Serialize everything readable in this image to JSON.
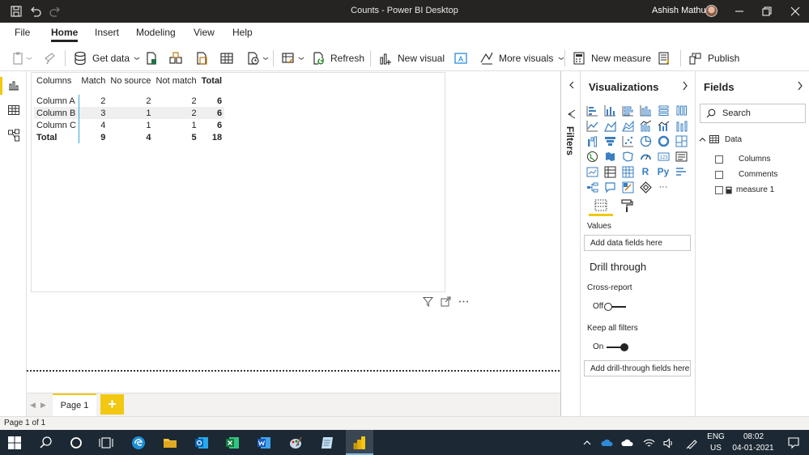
{
  "window": {
    "title": "Counts - Power BI Desktop",
    "user": "Ashish Mathur"
  },
  "ribbon": {
    "tabs": [
      "File",
      "Home",
      "Insert",
      "Modeling",
      "View",
      "Help"
    ],
    "active_tab": "Home",
    "buttons": {
      "get_data": "Get data",
      "refresh": "Refresh",
      "new_visual": "New visual",
      "more_visuals": "More visuals",
      "new_measure": "New measure",
      "publish": "Publish"
    }
  },
  "matrix": {
    "headers": [
      "Columns",
      "Match",
      "No source",
      "Not match",
      "Total"
    ],
    "rows": [
      {
        "label": "Column A",
        "values": [
          "2",
          "2",
          "2",
          "6"
        ]
      },
      {
        "label": "Column B",
        "values": [
          "3",
          "1",
          "2",
          "6"
        ]
      },
      {
        "label": "Column C",
        "values": [
          "4",
          "1",
          "1",
          "6"
        ]
      }
    ],
    "total": {
      "label": "Total",
      "values": [
        "9",
        "4",
        "5",
        "18"
      ]
    }
  },
  "pages": {
    "tabs": [
      "Page 1"
    ],
    "add_label": "+"
  },
  "status": {
    "text": "Page 1 of 1"
  },
  "filters": {
    "label": "Filters"
  },
  "visualizations": {
    "title": "Visualizations",
    "text_icons": {
      "r": "R",
      "py": "Py",
      "more": "···"
    },
    "values_label": "Values",
    "values_placeholder": "Add data fields here",
    "drill_title": "Drill through",
    "cross_report_label": "Cross-report",
    "cross_report_state": "Off",
    "keep_filters_label": "Keep all filters",
    "keep_filters_state": "On",
    "drill_placeholder": "Add drill-through fields here"
  },
  "fields": {
    "title": "Fields",
    "search_placeholder": "Search",
    "table_name": "Data",
    "items": [
      "Columns",
      "Comments",
      "measure 1"
    ]
  },
  "taskbar": {
    "lang": "ENG",
    "region": "US",
    "time": "08:02",
    "date": "04-01-2021"
  }
}
